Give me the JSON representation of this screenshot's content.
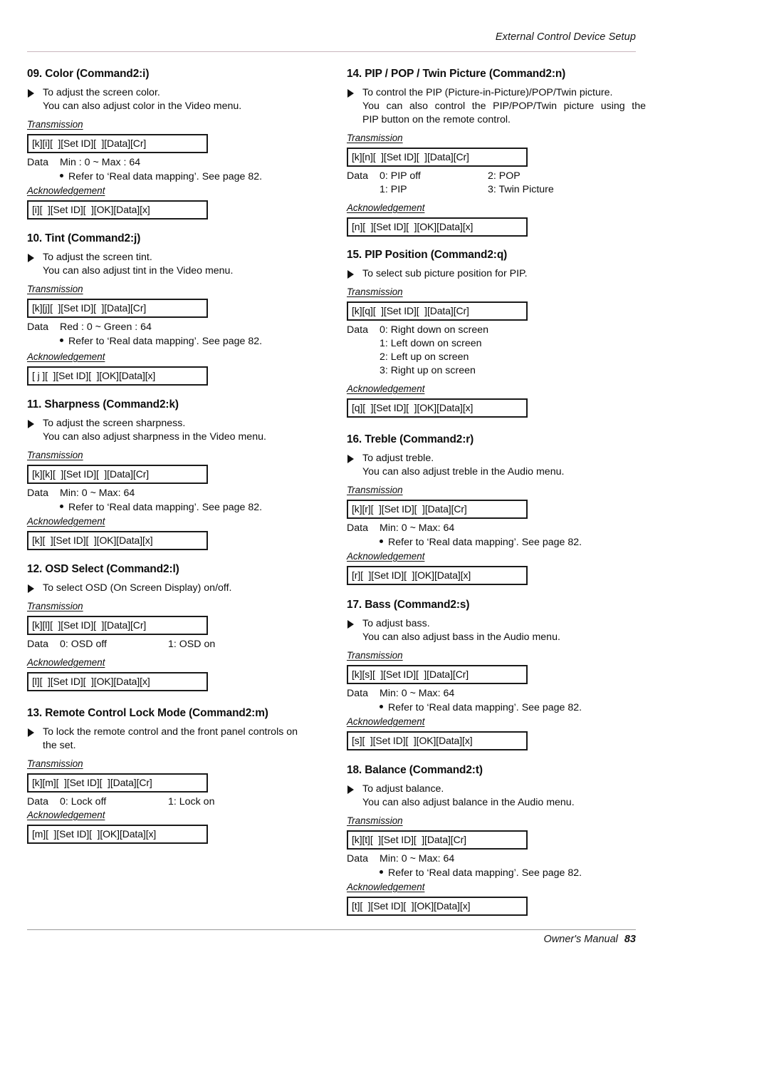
{
  "page": {
    "running_head": "External Control Device Setup",
    "footer_text": "Owner's Manual",
    "page_number": "83"
  },
  "labels": {
    "transmission": "Transmission",
    "acknowledgement": "Acknowledgement",
    "data": "Data",
    "note": "Refer to ‘Real data mapping’. See page 82."
  },
  "left_column": [
    {
      "title": "09. Color (Command2:i)",
      "desc_line1": "To adjust the screen color.",
      "desc_line2": "You can also adjust color in the Video menu.",
      "transmission": "[k][i][  ][Set ID][  ][Data][Cr]",
      "data_label": "Data",
      "data_value": "Min : 0 ~ Max : 64",
      "note": "Refer to ‘Real data mapping’. See page 82.",
      "acknowledgement": "[i][  ][Set ID][  ][OK][Data][x]"
    },
    {
      "title": "10. Tint (Command2:j)",
      "desc_line1": "To adjust the screen tint.",
      "desc_line2": "You can also adjust tint in the Video menu.",
      "transmission": "[k][j][  ][Set ID][  ][Data][Cr]",
      "data_label": "Data",
      "data_value": "Red : 0 ~ Green : 64",
      "note": "Refer to ‘Real data mapping’. See page 82.",
      "acknowledgement": "[ j ][  ][Set ID][  ][OK][Data][x]"
    },
    {
      "title": "11. Sharpness (Command2:k)",
      "desc_line1": "To adjust the screen sharpness.",
      "desc_line2": "You can also adjust sharpness in the Video menu.",
      "transmission": "[k][k][  ][Set ID][  ][Data][Cr]",
      "data_label": "Data",
      "data_value": "Min: 0 ~ Max: 64",
      "note": "Refer to ‘Real data mapping’. See page 82.",
      "acknowledgement": "[k][  ][Set ID][  ][OK][Data][x]"
    },
    {
      "title": "12. OSD Select (Command2:l)",
      "desc_line1": "To select OSD (On Screen Display) on/off.",
      "desc_line2": "",
      "transmission": "[k][l][  ][Set ID][  ][Data][Cr]",
      "data_label": "Data",
      "data_opt_a": "0: OSD off",
      "data_opt_b": "1: OSD on",
      "acknowledgement": "[l][  ][Set ID][  ][OK][Data][x]"
    },
    {
      "title": "13. Remote Control Lock Mode (Command2:m)",
      "desc_line1": "To lock the remote control and the front panel controls on",
      "desc_line2": "the set.",
      "transmission": "[k][m][  ][Set ID][  ][Data][Cr]",
      "data_label": "Data",
      "data_opt_a": "0: Lock off",
      "data_opt_b": "1: Lock on",
      "acknowledgement": "[m][  ][Set ID][  ][OK][Data][x]"
    }
  ],
  "right_column": [
    {
      "title": "14. PIP / POP / Twin Picture (Command2:n)",
      "desc_line1": "To control the PIP (Picture-in-Picture)/POP/Twin picture.",
      "desc_line2": "You can also control the PIP/POP/Twin picture using the",
      "desc_line3": "PIP button on the remote control.",
      "transmission": "[k][n][  ][Set ID][  ][Data][Cr]",
      "data_label": "Data",
      "data_rows": [
        {
          "a": "0: PIP off",
          "b": "2: POP"
        },
        {
          "a": "1: PIP",
          "b": "3: Twin Picture"
        }
      ],
      "acknowledgement": "[n][  ][Set ID][  ][OK][Data][x]"
    },
    {
      "title": "15. PIP Position (Command2:q)",
      "desc_line1": "To select sub picture position for PIP.",
      "desc_line2": "",
      "transmission": "[k][q][  ][Set ID][  ][Data][Cr]",
      "data_label": "Data",
      "data_list": [
        "0: Right down on screen",
        "1: Left down on screen",
        "2: Left up on screen",
        "3: Right up on screen"
      ],
      "acknowledgement": "[q][  ][Set ID][  ][OK][Data][x]"
    },
    {
      "title": "16. Treble (Command2:r)",
      "desc_line1": "To adjust treble.",
      "desc_line2": "You can also adjust treble in the Audio menu.",
      "transmission": "[k][r][  ][Set ID][  ][Data][Cr]",
      "data_label": "Data",
      "data_value": "Min: 0 ~ Max: 64",
      "note": "Refer to ‘Real data mapping’. See page 82.",
      "acknowledgement": "[r][  ][Set ID][  ][OK][Data][x]"
    },
    {
      "title": "17. Bass (Command2:s)",
      "desc_line1": "To adjust bass.",
      "desc_line2": "You can also adjust bass in the Audio menu.",
      "transmission": "[k][s][  ][Set ID][  ][Data][Cr]",
      "data_label": "Data",
      "data_value": "Min: 0 ~ Max: 64",
      "note": "Refer to ‘Real data mapping’. See page 82.",
      "acknowledgement": "[s][  ][Set ID][  ][OK][Data][x]"
    },
    {
      "title": "18. Balance (Command2:t)",
      "desc_line1": "To adjust balance.",
      "desc_line2": "You can also adjust balance in the Audio menu.",
      "transmission": "[k][t][  ][Set ID][  ][Data][Cr]",
      "data_label": "Data",
      "data_value": "Min: 0 ~ Max: 64",
      "note": "Refer to ‘Real data mapping’. See page 82.",
      "acknowledgement": "[t][  ][Set ID][  ][OK][Data][x]"
    }
  ]
}
